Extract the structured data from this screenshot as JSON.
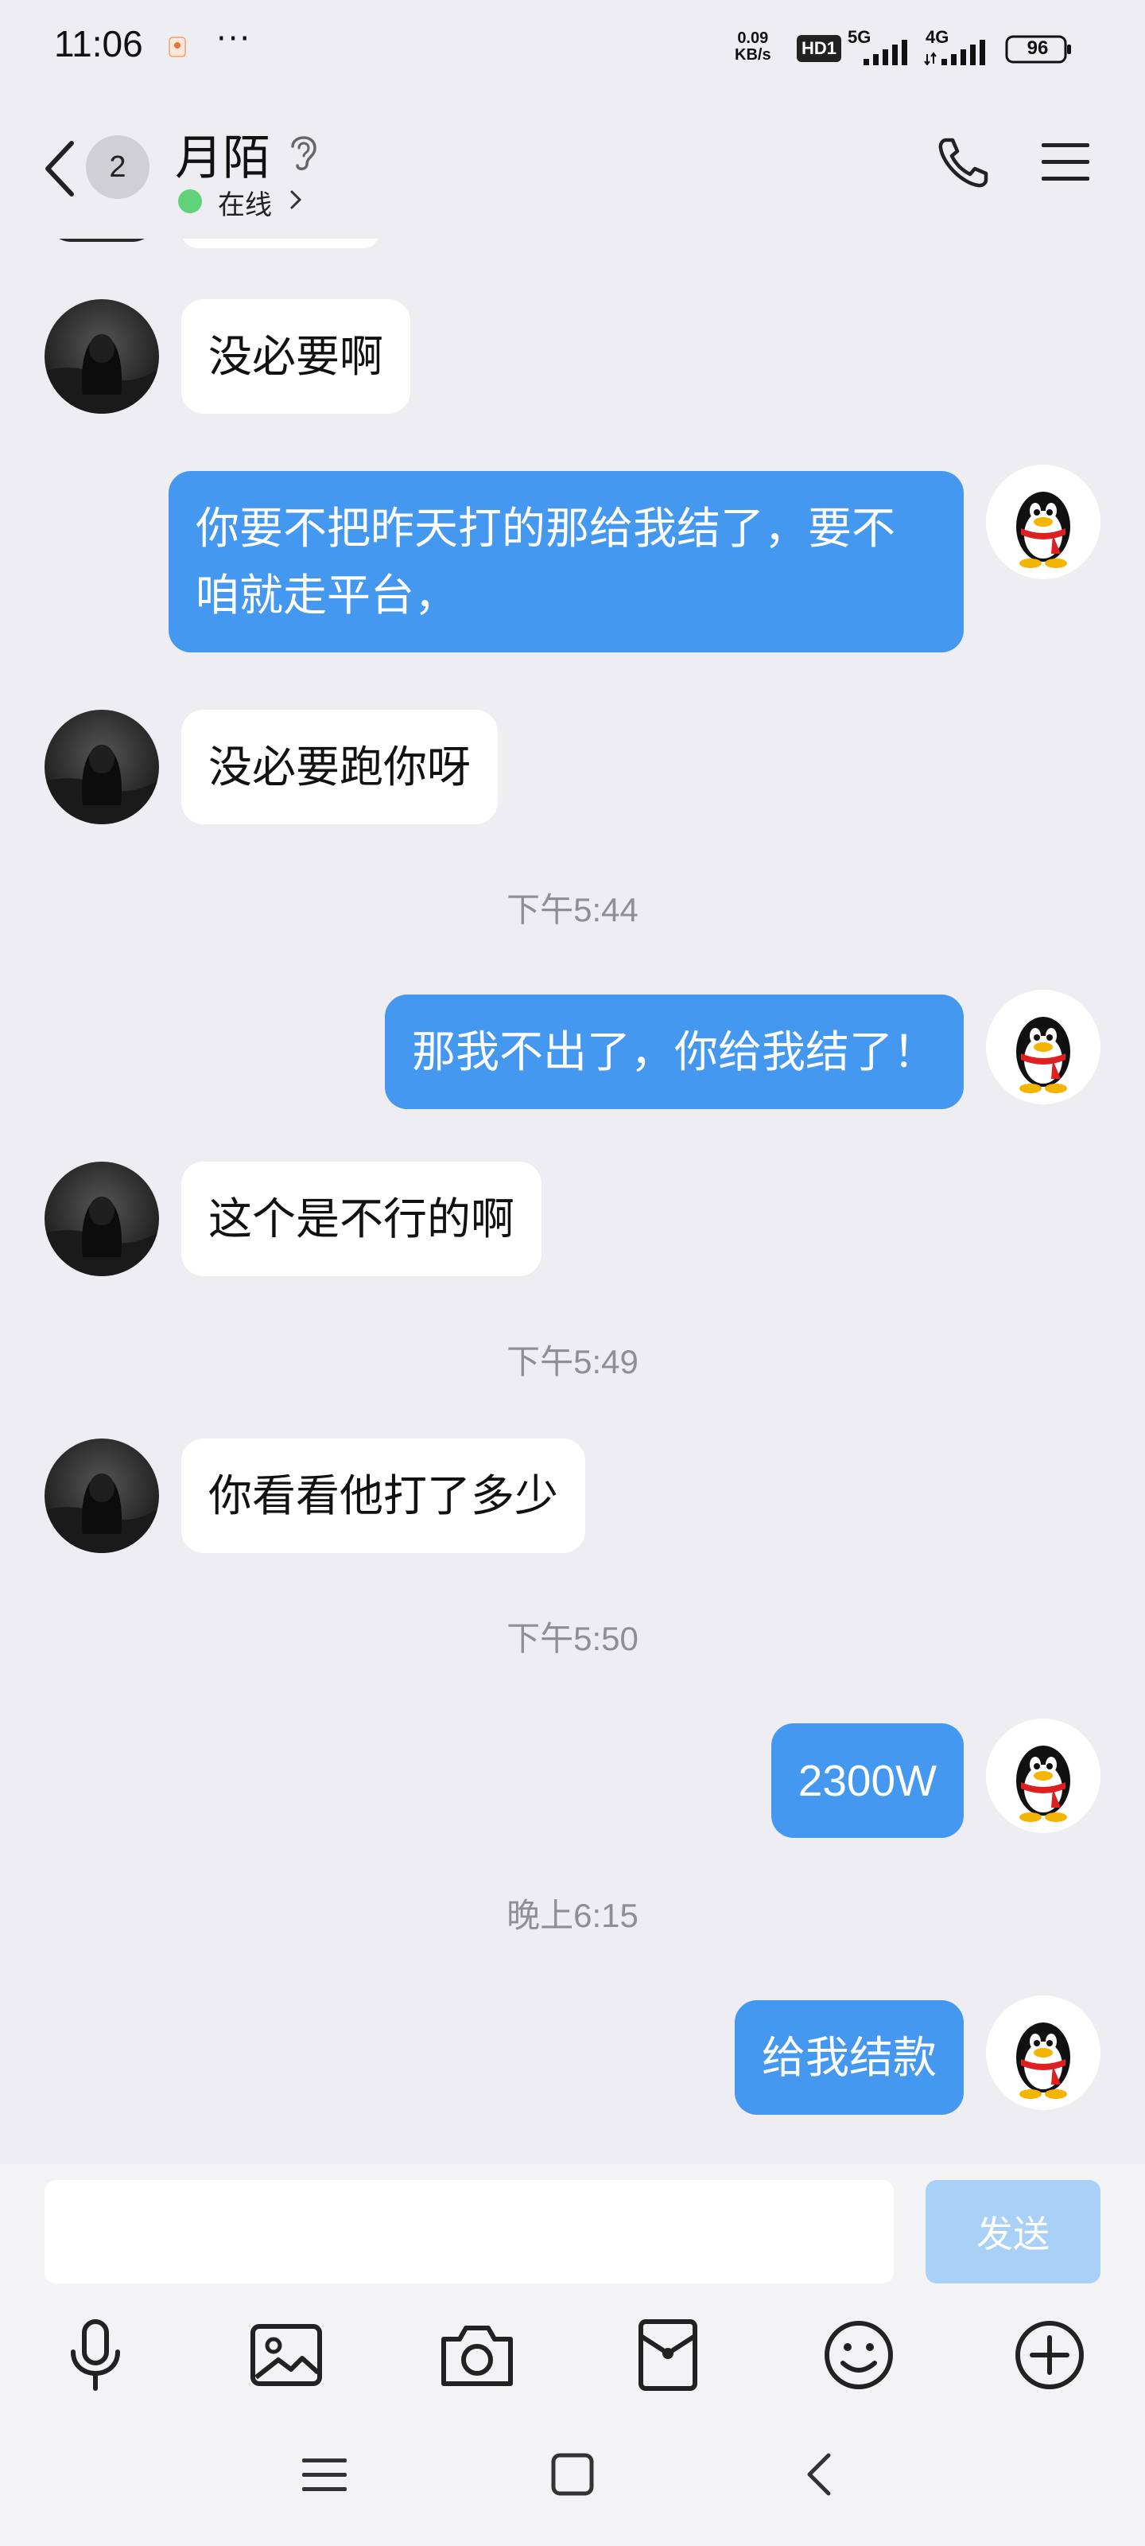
{
  "status_bar": {
    "time": "11:06",
    "more": "···",
    "net_speed_value": "0.09",
    "net_speed_unit": "KB/s",
    "hd_badge": "HD1",
    "signal_1": "5G",
    "signal_2": "4G",
    "battery": "96"
  },
  "header": {
    "unread_count": "2",
    "contact_name": "月陌",
    "presence": "在线"
  },
  "chat": {
    "messages": [
      {
        "side": "left",
        "text": "没必要啊"
      },
      {
        "side": "right",
        "text": "你要不把昨天打的那给我结了，要不咱就走平台，"
      },
      {
        "side": "left",
        "text": "没必要跑你呀"
      },
      {
        "side": "time",
        "text": "下午5:44"
      },
      {
        "side": "right",
        "text": "那我不出了，你给我结了！"
      },
      {
        "side": "left",
        "text": "这个是不行的啊"
      },
      {
        "side": "time",
        "text": "下午5:49"
      },
      {
        "side": "left",
        "text": "你看看他打了多少"
      },
      {
        "side": "time",
        "text": "下午5:50"
      },
      {
        "side": "right",
        "text": "2300W"
      },
      {
        "side": "time",
        "text": "晚上6:15"
      },
      {
        "side": "right",
        "text": "给我结款"
      }
    ]
  },
  "input": {
    "placeholder": "",
    "send_label": "发送"
  },
  "toolbar": {
    "items": [
      "microphone-icon",
      "image-icon",
      "camera-icon",
      "red-packet-icon",
      "emoji-icon",
      "plus-icon"
    ]
  },
  "nav": {
    "items": [
      "recents-menu-icon",
      "home-square-icon",
      "back-arrow-icon"
    ]
  },
  "colors": {
    "background": "#ededf2",
    "outgoing_bubble": "#4598f0",
    "incoming_bubble": "#ffffff",
    "send_button_disabled": "#a9d0f7",
    "online_dot": "#5fd27a",
    "timestamp_text": "#8e8e93"
  }
}
